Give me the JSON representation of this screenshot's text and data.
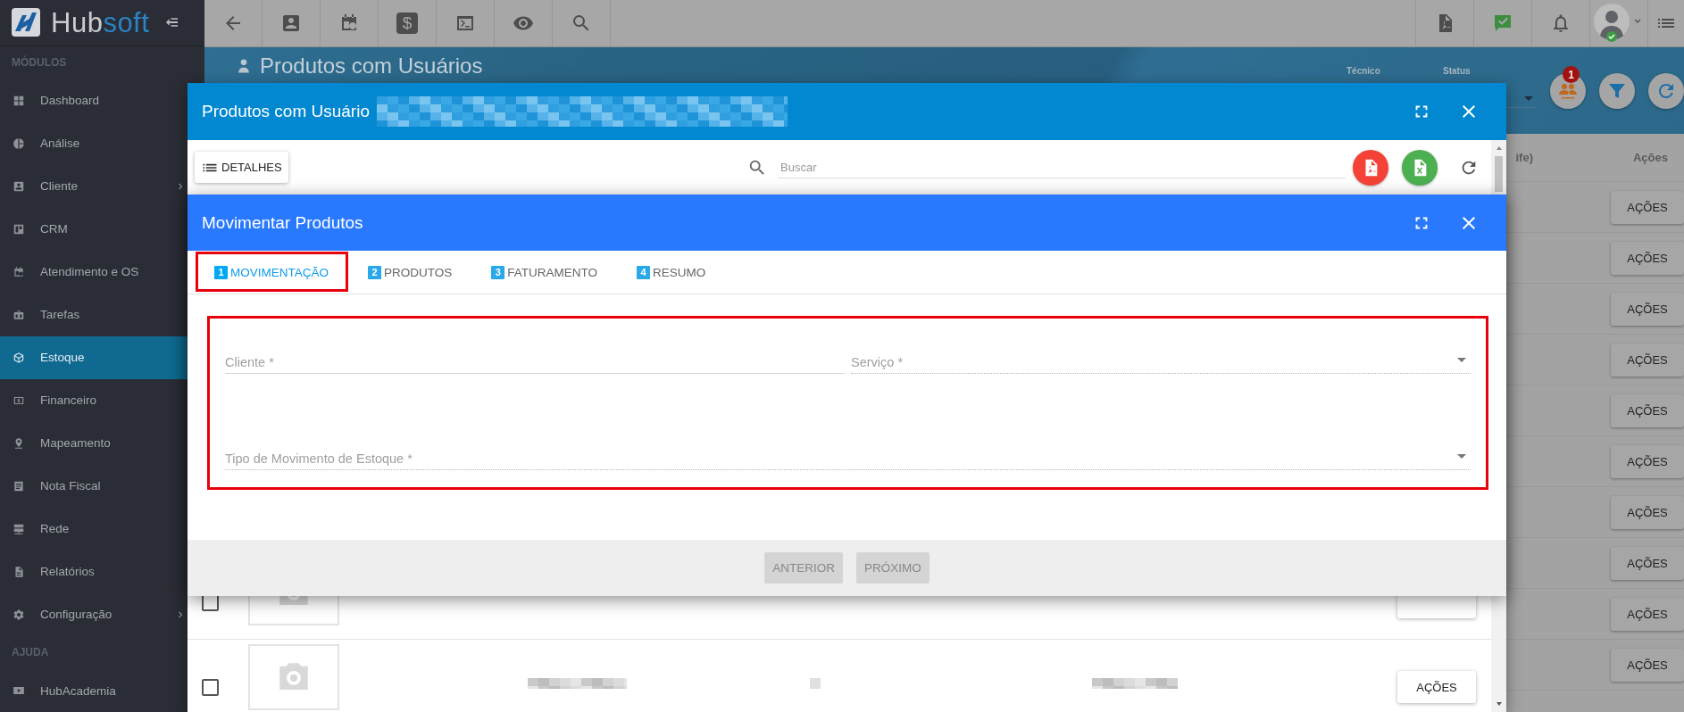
{
  "sidebar": {
    "logo": "Hubsoft",
    "sections": [
      {
        "title": "MÓDULOS",
        "items": [
          {
            "label": "Dashboard",
            "selected": false,
            "expandable": false
          },
          {
            "label": "Análise",
            "selected": false,
            "expandable": false
          },
          {
            "label": "Cliente",
            "selected": false,
            "expandable": true
          },
          {
            "label": "CRM",
            "selected": false,
            "expandable": false
          },
          {
            "label": "Atendimento e OS",
            "selected": false,
            "expandable": false
          },
          {
            "label": "Tarefas",
            "selected": false,
            "expandable": false
          },
          {
            "label": "Estoque",
            "selected": true,
            "expandable": false
          },
          {
            "label": "Financeiro",
            "selected": false,
            "expandable": false
          },
          {
            "label": "Mapeamento",
            "selected": false,
            "expandable": false
          },
          {
            "label": "Nota Fiscal",
            "selected": false,
            "expandable": false
          },
          {
            "label": "Rede",
            "selected": false,
            "expandable": false
          },
          {
            "label": "Relatórios",
            "selected": false,
            "expandable": false
          },
          {
            "label": "Configuração",
            "selected": false,
            "expandable": true
          }
        ]
      },
      {
        "title": "AJUDA",
        "items": [
          {
            "label": "HubAcademia",
            "selected": false,
            "expandable": false
          }
        ]
      }
    ]
  },
  "toolbar": {
    "money_symbol": "$"
  },
  "page_header": {
    "title": "Produtos com Usuários",
    "filters": [
      {
        "label": "Técnico"
      },
      {
        "label": "Status"
      }
    ],
    "team_badge": "1"
  },
  "background_table": {
    "columns": [
      "ife)",
      "Ações"
    ],
    "rows": [
      {
        "action": "AÇÕES"
      },
      {
        "action": "AÇÕES"
      },
      {
        "action": "AÇÕES"
      },
      {
        "action": "AÇÕES"
      },
      {
        "action": "AÇÕES"
      },
      {
        "action": "AÇÕES"
      },
      {
        "action": "AÇÕES"
      },
      {
        "action": "AÇÕES"
      },
      {
        "action": "AÇÕES"
      },
      {
        "action": "AÇÕES"
      }
    ]
  },
  "products_dialog": {
    "title": "Produtos com Usuário",
    "details_button": "DETALHES",
    "search": {
      "placeholder": "Buscar"
    },
    "rows": [
      {
        "checked": false
      },
      {
        "checked": false,
        "action": "AÇÕES"
      }
    ]
  },
  "move_dialog": {
    "title": "Movimentar Produtos",
    "tabs": [
      {
        "number": "1",
        "label": "MOVIMENTAÇÃO",
        "selected": true
      },
      {
        "number": "2",
        "label": "PRODUTOS",
        "selected": false
      },
      {
        "number": "3",
        "label": "FATURAMENTO",
        "selected": false
      },
      {
        "number": "4",
        "label": "RESUMO",
        "selected": false
      }
    ],
    "fields": [
      {
        "label": "Cliente *",
        "kind": "text"
      },
      {
        "label": "Serviço *",
        "kind": "select"
      },
      {
        "label": "Tipo de Movimento de Estoque *",
        "kind": "select"
      }
    ],
    "buttons": [
      {
        "label": "ANTERIOR",
        "disabled": true
      },
      {
        "label": "PRÓXIMO",
        "disabled": true
      }
    ]
  }
}
